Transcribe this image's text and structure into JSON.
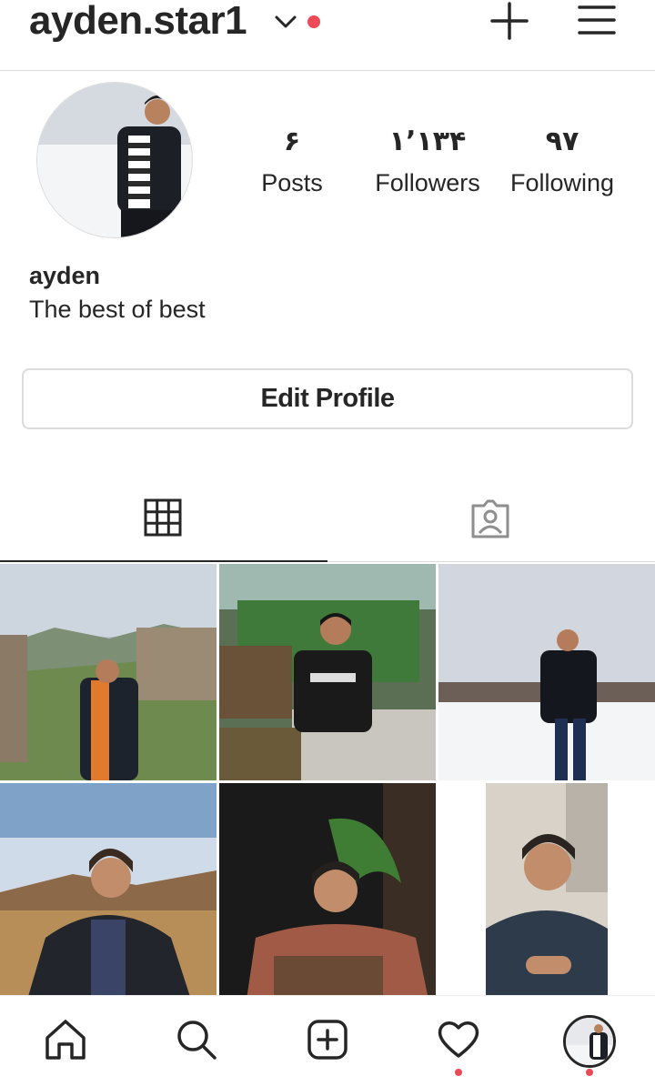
{
  "header": {
    "username": "ayden.star1",
    "has_notification_dot": true,
    "icons": [
      "chevron-down-icon",
      "new-post-plus-icon",
      "menu-icon"
    ]
  },
  "profile": {
    "stats": [
      {
        "value": "۶",
        "label": "Posts"
      },
      {
        "value": "۱٬۱۳۴",
        "label": "Followers"
      },
      {
        "value": "۹۷",
        "label": "Following"
      }
    ],
    "full_name": "ayden",
    "bio": "The best of best",
    "edit_button_label": "Edit Profile"
  },
  "tabs": [
    {
      "name": "grid",
      "icon": "grid-icon",
      "active": true
    },
    {
      "name": "tagged",
      "icon": "tagged-user-icon",
      "active": false
    }
  ],
  "posts_count_visible": 6,
  "bottom_nav": {
    "items": [
      "home-icon",
      "search-icon",
      "add-post-icon",
      "heart-icon",
      "profile-avatar"
    ],
    "activity_dot_on": [
      "heart-icon",
      "profile-avatar"
    ]
  },
  "colors": {
    "text": "#262626",
    "border": "#dbdbdb",
    "notification_dot": "#ed4956"
  }
}
